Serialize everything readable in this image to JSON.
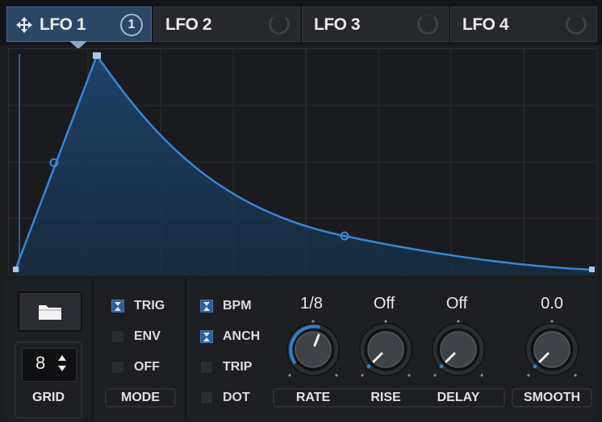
{
  "tabs": [
    {
      "label": "LFO 1",
      "badge": "1",
      "active": true
    },
    {
      "label": "LFO 2",
      "active": false
    },
    {
      "label": "LFO 3",
      "active": false
    },
    {
      "label": "LFO 4",
      "active": false
    }
  ],
  "grid": {
    "value": "8",
    "label": "GRID"
  },
  "mode": {
    "label": "MODE",
    "options": [
      {
        "label": "TRIG",
        "checked": true
      },
      {
        "label": "ENV",
        "checked": false
      },
      {
        "label": "OFF",
        "checked": false
      }
    ]
  },
  "timing": {
    "options": [
      {
        "label": "BPM",
        "checked": true
      },
      {
        "label": "ANCH",
        "checked": true
      },
      {
        "label": "TRIP",
        "checked": false
      },
      {
        "label": "DOT",
        "checked": false
      }
    ]
  },
  "knobs": {
    "rate": {
      "label": "RATE",
      "value": "1/8"
    },
    "rise": {
      "label": "RISE",
      "value": "Off"
    },
    "delay": {
      "label": "DELAY",
      "value": "Off"
    },
    "smooth": {
      "label": "SMOOTH",
      "value": "0.0"
    }
  },
  "colors": {
    "accent": "#3a7fd0",
    "active_tab": "#2c4766",
    "background": "#1c1d20"
  }
}
